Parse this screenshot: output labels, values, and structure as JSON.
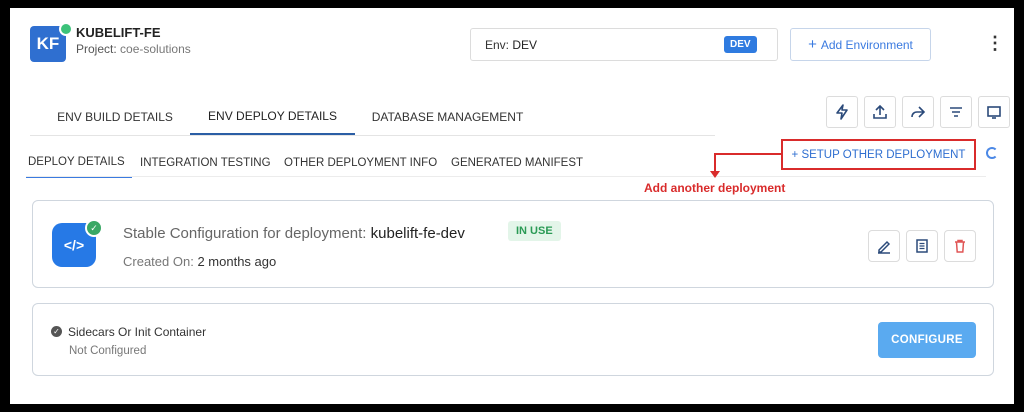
{
  "header": {
    "avatar_initials": "KF",
    "app_name": "KUBELIFT-FE",
    "project_label": "Project:",
    "project_value": "coe-solutions"
  },
  "env_select": {
    "label": "Env:",
    "value": "DEV",
    "badge": "DEV"
  },
  "add_environment": {
    "icon": "+",
    "label": "Add Environment"
  },
  "menu_icon": "⋮",
  "tabs": [
    {
      "label": "ENV BUILD DETAILS",
      "active": false
    },
    {
      "label": "ENV DEPLOY DETAILS",
      "active": true
    },
    {
      "label": "DATABASE MANAGEMENT",
      "active": false
    }
  ],
  "toolbar_icons": [
    "lightning-icon",
    "upload-icon",
    "share-icon",
    "filter-icon",
    "preview-icon"
  ],
  "subtabs": [
    {
      "label": "DEPLOY DETAILS",
      "active": true
    },
    {
      "label": "INTEGRATION TESTING",
      "active": false
    },
    {
      "label": "OTHER DEPLOYMENT INFO",
      "active": false
    },
    {
      "label": "GENERATED MANIFEST",
      "active": false
    }
  ],
  "setup_other_deployment": "+ SETUP OTHER DEPLOYMENT",
  "annotation": "Add another deployment",
  "deployment_card": {
    "icon_text": "</>",
    "title_prefix": "Stable Configuration for deployment:",
    "deployment_name": "kubelift-fe-dev",
    "status_badge": "IN USE",
    "created_label": "Created On:",
    "created_value": "2 months ago",
    "actions": [
      "edit-icon",
      "document-icon",
      "delete-icon"
    ]
  },
  "sidecar_card": {
    "title": "Sidecars Or Init Container",
    "status": "Not Configured",
    "button": "CONFIGURE"
  },
  "colors": {
    "primary": "#2f7be0",
    "annotation_red": "#d92b2b",
    "success_green": "#2a9a55",
    "delete_red": "#e05555"
  }
}
